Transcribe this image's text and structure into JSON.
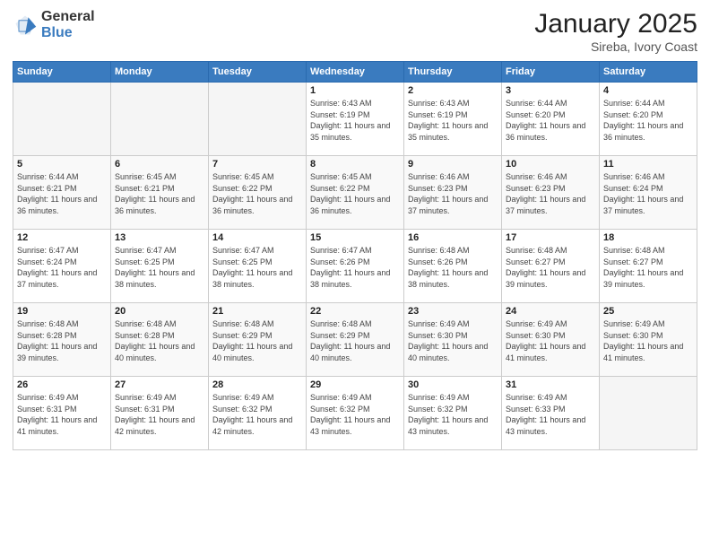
{
  "logo": {
    "general": "General",
    "blue": "Blue"
  },
  "title": "January 2025",
  "subtitle": "Sireba, Ivory Coast",
  "weekdays": [
    "Sunday",
    "Monday",
    "Tuesday",
    "Wednesday",
    "Thursday",
    "Friday",
    "Saturday"
  ],
  "weeks": [
    [
      {
        "day": "",
        "sunrise": "",
        "sunset": "",
        "daylight": ""
      },
      {
        "day": "",
        "sunrise": "",
        "sunset": "",
        "daylight": ""
      },
      {
        "day": "",
        "sunrise": "",
        "sunset": "",
        "daylight": ""
      },
      {
        "day": "1",
        "sunrise": "Sunrise: 6:43 AM",
        "sunset": "Sunset: 6:19 PM",
        "daylight": "Daylight: 11 hours and 35 minutes."
      },
      {
        "day": "2",
        "sunrise": "Sunrise: 6:43 AM",
        "sunset": "Sunset: 6:19 PM",
        "daylight": "Daylight: 11 hours and 35 minutes."
      },
      {
        "day": "3",
        "sunrise": "Sunrise: 6:44 AM",
        "sunset": "Sunset: 6:20 PM",
        "daylight": "Daylight: 11 hours and 36 minutes."
      },
      {
        "day": "4",
        "sunrise": "Sunrise: 6:44 AM",
        "sunset": "Sunset: 6:20 PM",
        "daylight": "Daylight: 11 hours and 36 minutes."
      }
    ],
    [
      {
        "day": "5",
        "sunrise": "Sunrise: 6:44 AM",
        "sunset": "Sunset: 6:21 PM",
        "daylight": "Daylight: 11 hours and 36 minutes."
      },
      {
        "day": "6",
        "sunrise": "Sunrise: 6:45 AM",
        "sunset": "Sunset: 6:21 PM",
        "daylight": "Daylight: 11 hours and 36 minutes."
      },
      {
        "day": "7",
        "sunrise": "Sunrise: 6:45 AM",
        "sunset": "Sunset: 6:22 PM",
        "daylight": "Daylight: 11 hours and 36 minutes."
      },
      {
        "day": "8",
        "sunrise": "Sunrise: 6:45 AM",
        "sunset": "Sunset: 6:22 PM",
        "daylight": "Daylight: 11 hours and 36 minutes."
      },
      {
        "day": "9",
        "sunrise": "Sunrise: 6:46 AM",
        "sunset": "Sunset: 6:23 PM",
        "daylight": "Daylight: 11 hours and 37 minutes."
      },
      {
        "day": "10",
        "sunrise": "Sunrise: 6:46 AM",
        "sunset": "Sunset: 6:23 PM",
        "daylight": "Daylight: 11 hours and 37 minutes."
      },
      {
        "day": "11",
        "sunrise": "Sunrise: 6:46 AM",
        "sunset": "Sunset: 6:24 PM",
        "daylight": "Daylight: 11 hours and 37 minutes."
      }
    ],
    [
      {
        "day": "12",
        "sunrise": "Sunrise: 6:47 AM",
        "sunset": "Sunset: 6:24 PM",
        "daylight": "Daylight: 11 hours and 37 minutes."
      },
      {
        "day": "13",
        "sunrise": "Sunrise: 6:47 AM",
        "sunset": "Sunset: 6:25 PM",
        "daylight": "Daylight: 11 hours and 38 minutes."
      },
      {
        "day": "14",
        "sunrise": "Sunrise: 6:47 AM",
        "sunset": "Sunset: 6:25 PM",
        "daylight": "Daylight: 11 hours and 38 minutes."
      },
      {
        "day": "15",
        "sunrise": "Sunrise: 6:47 AM",
        "sunset": "Sunset: 6:26 PM",
        "daylight": "Daylight: 11 hours and 38 minutes."
      },
      {
        "day": "16",
        "sunrise": "Sunrise: 6:48 AM",
        "sunset": "Sunset: 6:26 PM",
        "daylight": "Daylight: 11 hours and 38 minutes."
      },
      {
        "day": "17",
        "sunrise": "Sunrise: 6:48 AM",
        "sunset": "Sunset: 6:27 PM",
        "daylight": "Daylight: 11 hours and 39 minutes."
      },
      {
        "day": "18",
        "sunrise": "Sunrise: 6:48 AM",
        "sunset": "Sunset: 6:27 PM",
        "daylight": "Daylight: 11 hours and 39 minutes."
      }
    ],
    [
      {
        "day": "19",
        "sunrise": "Sunrise: 6:48 AM",
        "sunset": "Sunset: 6:28 PM",
        "daylight": "Daylight: 11 hours and 39 minutes."
      },
      {
        "day": "20",
        "sunrise": "Sunrise: 6:48 AM",
        "sunset": "Sunset: 6:28 PM",
        "daylight": "Daylight: 11 hours and 40 minutes."
      },
      {
        "day": "21",
        "sunrise": "Sunrise: 6:48 AM",
        "sunset": "Sunset: 6:29 PM",
        "daylight": "Daylight: 11 hours and 40 minutes."
      },
      {
        "day": "22",
        "sunrise": "Sunrise: 6:48 AM",
        "sunset": "Sunset: 6:29 PM",
        "daylight": "Daylight: 11 hours and 40 minutes."
      },
      {
        "day": "23",
        "sunrise": "Sunrise: 6:49 AM",
        "sunset": "Sunset: 6:30 PM",
        "daylight": "Daylight: 11 hours and 40 minutes."
      },
      {
        "day": "24",
        "sunrise": "Sunrise: 6:49 AM",
        "sunset": "Sunset: 6:30 PM",
        "daylight": "Daylight: 11 hours and 41 minutes."
      },
      {
        "day": "25",
        "sunrise": "Sunrise: 6:49 AM",
        "sunset": "Sunset: 6:30 PM",
        "daylight": "Daylight: 11 hours and 41 minutes."
      }
    ],
    [
      {
        "day": "26",
        "sunrise": "Sunrise: 6:49 AM",
        "sunset": "Sunset: 6:31 PM",
        "daylight": "Daylight: 11 hours and 41 minutes."
      },
      {
        "day": "27",
        "sunrise": "Sunrise: 6:49 AM",
        "sunset": "Sunset: 6:31 PM",
        "daylight": "Daylight: 11 hours and 42 minutes."
      },
      {
        "day": "28",
        "sunrise": "Sunrise: 6:49 AM",
        "sunset": "Sunset: 6:32 PM",
        "daylight": "Daylight: 11 hours and 42 minutes."
      },
      {
        "day": "29",
        "sunrise": "Sunrise: 6:49 AM",
        "sunset": "Sunset: 6:32 PM",
        "daylight": "Daylight: 11 hours and 43 minutes."
      },
      {
        "day": "30",
        "sunrise": "Sunrise: 6:49 AM",
        "sunset": "Sunset: 6:32 PM",
        "daylight": "Daylight: 11 hours and 43 minutes."
      },
      {
        "day": "31",
        "sunrise": "Sunrise: 6:49 AM",
        "sunset": "Sunset: 6:33 PM",
        "daylight": "Daylight: 11 hours and 43 minutes."
      },
      {
        "day": "",
        "sunrise": "",
        "sunset": "",
        "daylight": ""
      }
    ]
  ]
}
